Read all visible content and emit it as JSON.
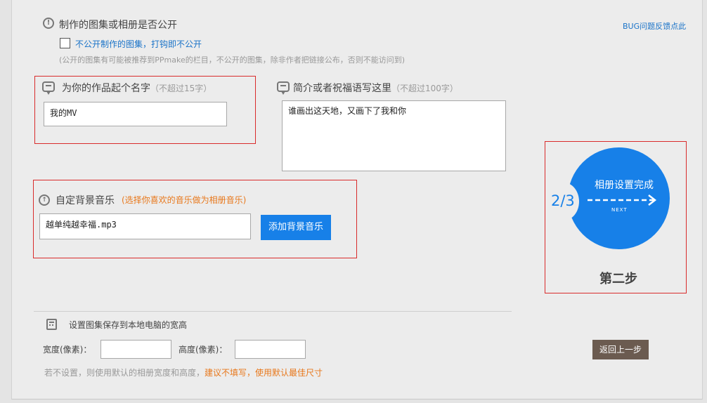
{
  "privacy": {
    "title": "制作的图集或相册是否公开",
    "checkbox_label": "不公开制作的图集，打钩即不公开",
    "note": "(公开的图集有可能被推荐到PPmake的栏目，不公开的图集，除非作者把链接公布，否则不能访问到)"
  },
  "bug_link": "BUG问题反馈点此",
  "name_section": {
    "title": "为你的作品起个名字",
    "hint": "（不超过15字）",
    "value": "我的MV"
  },
  "desc_section": {
    "title": "简介或者祝福语写这里",
    "hint": "（不超过100字）",
    "value": "谁画出这天地，又画下了我和你"
  },
  "music_section": {
    "title": "自定背景音乐",
    "hint": "(选择你喜欢的音乐做为相册音乐)",
    "value": "越单纯越幸福.mp3",
    "add_button": "添加背景音乐"
  },
  "step": {
    "progress": "2/3",
    "circle_label": "相册设置完成",
    "next_label": "NEXT",
    "caption": "第二步"
  },
  "size_section": {
    "title": "设置图集保存到本地电脑的宽高",
    "width_label": "宽度(像素)：",
    "height_label": "高度(像素)：",
    "width_value": "",
    "height_value": "",
    "note_prefix": "若不设置，则使用默认的相册宽度和高度，",
    "note_highlight": "建议不填写，使用默认最佳尺寸"
  },
  "back_button": "返回上一步",
  "colors": {
    "accent": "#1780e8",
    "highlight": "#e8781c",
    "frame": "#d92b2b",
    "back_button": "#6b5b50"
  }
}
